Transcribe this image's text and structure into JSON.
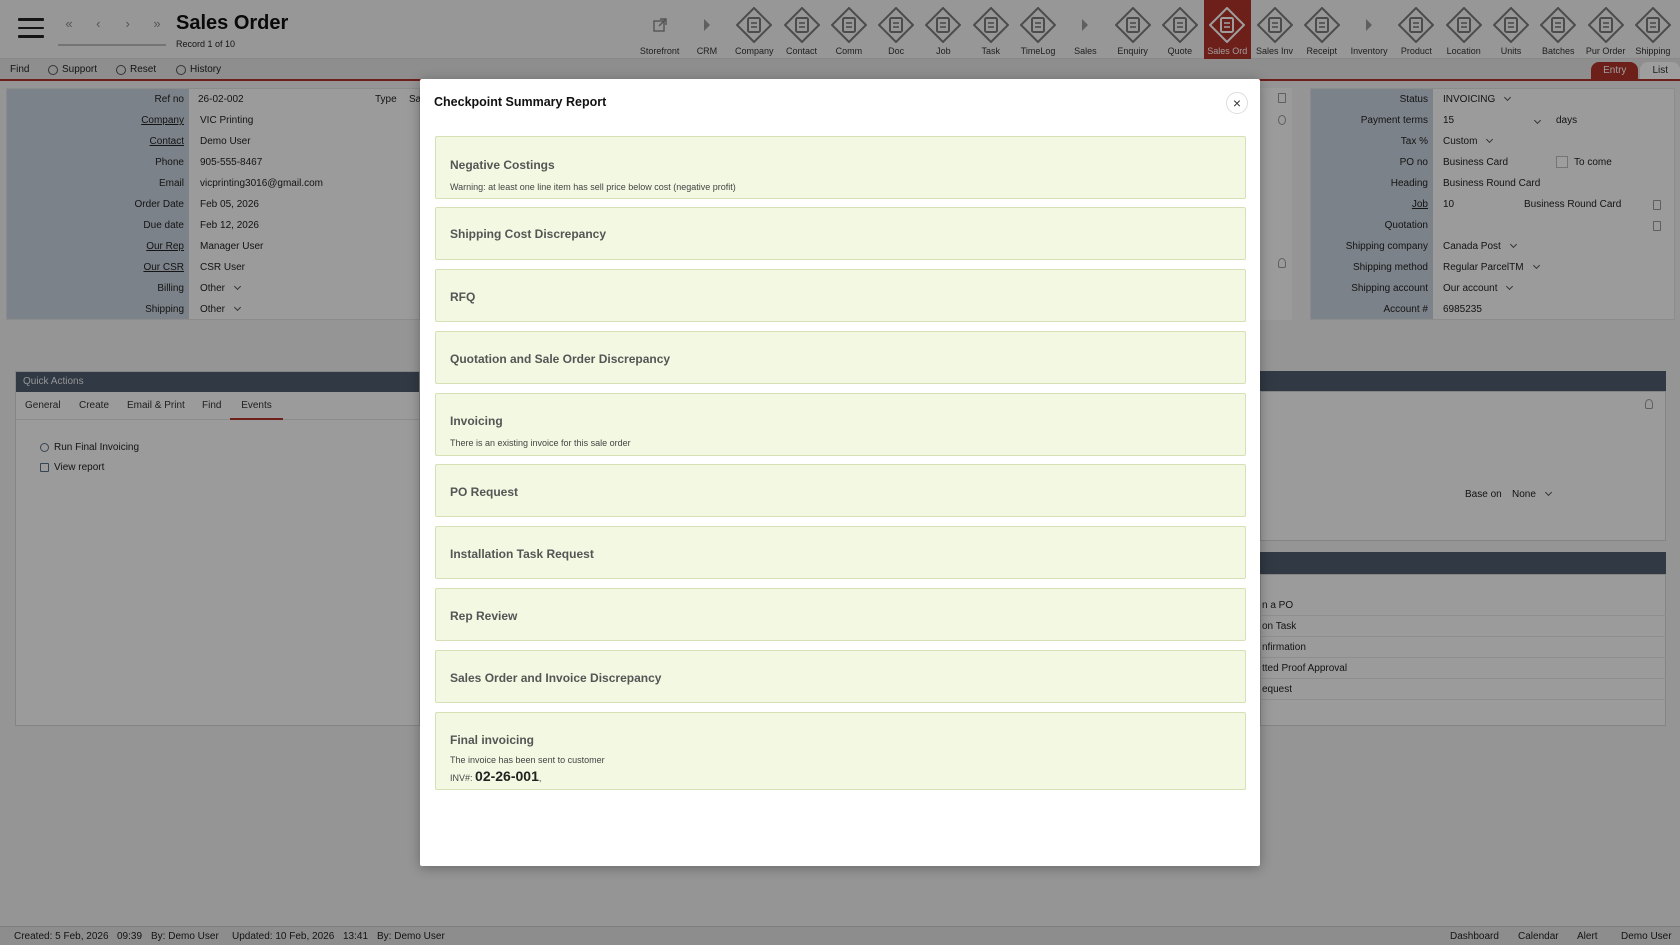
{
  "header": {
    "title": "Sales Order",
    "record": "Record 1 of 10",
    "modules": [
      {
        "label": "Storefront",
        "icon": "external-link-icon"
      },
      {
        "label": "CRM",
        "icon": "arrow-right-icon"
      },
      {
        "label": "Company",
        "icon": "company-icon"
      },
      {
        "label": "Contact",
        "icon": "contact-icon"
      },
      {
        "label": "Comm",
        "icon": "comm-icon"
      },
      {
        "label": "Doc",
        "icon": "doc-icon"
      },
      {
        "label": "Job",
        "icon": "job-icon"
      },
      {
        "label": "Task",
        "icon": "task-icon"
      },
      {
        "label": "TimeLog",
        "icon": "timelog-icon"
      },
      {
        "label": "Sales",
        "icon": "arrow-right-icon"
      },
      {
        "label": "Enquiry",
        "icon": "enquiry-icon"
      },
      {
        "label": "Quote",
        "icon": "quote-icon"
      },
      {
        "label": "Sales Ord",
        "icon": "sales-order-icon"
      },
      {
        "label": "Sales Inv",
        "icon": "sales-invoice-icon"
      },
      {
        "label": "Receipt",
        "icon": "receipt-icon"
      },
      {
        "label": "Inventory",
        "icon": "arrow-right-icon"
      },
      {
        "label": "Product",
        "icon": "product-icon"
      },
      {
        "label": "Location",
        "icon": "location-icon"
      },
      {
        "label": "Units",
        "icon": "units-icon"
      },
      {
        "label": "Batches",
        "icon": "batches-icon"
      },
      {
        "label": "Pur Order",
        "icon": "purchase-order-icon"
      },
      {
        "label": "Shipping",
        "icon": "shipping-icon"
      }
    ],
    "active_module": "Sales Ord",
    "active_color": "#b0322a"
  },
  "toolbar": {
    "find": "Find",
    "support": "Support",
    "reset": "Reset",
    "history": "History",
    "entry": "Entry",
    "list": "List"
  },
  "form_left": {
    "ref_label": "Ref no",
    "ref": "26-02-002",
    "type_label": "Type",
    "type": "Sa",
    "company_label": "Company",
    "company": "VIC Printing",
    "contact_label": "Contact",
    "contact": "Demo User",
    "phone_label": "Phone",
    "phone": "905-555-8467",
    "email_label": "Email",
    "email": "vicprinting3016@gmail.com",
    "order_date_label": "Order Date",
    "order_date": "Feb 05, 2026",
    "due_date_label": "Due date",
    "due_date": "Feb 12, 2026",
    "our_rep_label": "Our Rep",
    "our_rep": "Manager User",
    "our_csr_label": "Our CSR",
    "our_csr": "CSR User",
    "billing_label": "Billing",
    "billing": "Other",
    "shipping_label": "Shipping",
    "shipping": "Other"
  },
  "form_right": {
    "status_label": "Status",
    "status": "INVOICING",
    "payment_terms_label": "Payment terms",
    "payment_terms": "15",
    "days": "days",
    "tax_label": "Tax %",
    "tax": "Custom",
    "po_label": "PO no",
    "po": "Business Card",
    "to_come": "To come",
    "heading_label": "Heading",
    "heading": "Business Round Card",
    "job_label": "Job",
    "job_no": "10",
    "job_name": "Business Round Card",
    "quotation_label": "Quotation",
    "shipping_company_label": "Shipping company",
    "shipping_company": "Canada Post",
    "shipping_method_label": "Shipping method",
    "shipping_method": "Regular ParcelTM",
    "shipping_account_label": "Shipping account",
    "shipping_account": "Our account",
    "account_label": "Account #",
    "account": "6985235"
  },
  "quick_actions": {
    "title": "Quick Actions",
    "tabs": [
      "General",
      "Create",
      "Email & Print",
      "Find",
      "Events"
    ],
    "active_tab": "Events",
    "items": [
      "Run Final Invoicing",
      "View report"
    ]
  },
  "right_panel": {
    "base_on_label": "Base on",
    "base_on": "None",
    "rows": [
      "n a PO",
      "on Task",
      "nfirmation",
      "tted Proof Approval",
      "equest"
    ]
  },
  "modal": {
    "title": "Checkpoint Summary Report",
    "close": "×",
    "cards": [
      {
        "title": "Negative Costings",
        "desc": "Warning: at least one line item has sell price below cost (negative profit)"
      },
      {
        "title": "Shipping Cost Discrepancy",
        "desc": ""
      },
      {
        "title": "RFQ",
        "desc": ""
      },
      {
        "title": "Quotation and Sale Order Discrepancy",
        "desc": ""
      },
      {
        "title": "Invoicing",
        "desc": "There is an existing invoice for this sale order"
      },
      {
        "title": "PO Request",
        "desc": ""
      },
      {
        "title": "Installation Task Request",
        "desc": ""
      },
      {
        "title": "Rep Review",
        "desc": ""
      },
      {
        "title": "Sales Order and Invoice Discrepancy",
        "desc": ""
      },
      {
        "title": "Final invoicing",
        "desc": "The invoice has been sent to customer"
      }
    ],
    "inv_prefix": "INV#:",
    "inv_number": "02-26-001",
    "inv_suffix": ","
  },
  "statusbar": {
    "created": "Created: 5 Feb, 2026",
    "created_time": "09:39",
    "created_by": "By: Demo User",
    "updated": "Updated: 10 Feb, 2026",
    "updated_time": "13:41",
    "updated_by": "By: Demo User",
    "links": [
      "Dashboard",
      "Calendar",
      "Alert",
      "Demo User"
    ]
  }
}
